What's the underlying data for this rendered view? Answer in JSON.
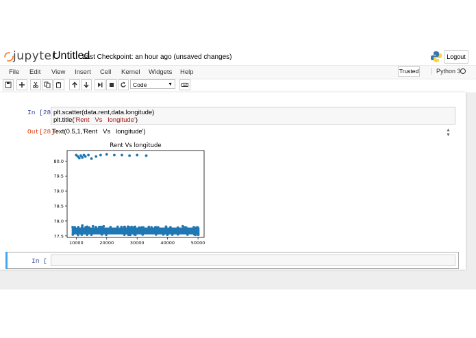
{
  "header": {
    "logo_text": "jupyter",
    "notebook_name": "Untitled",
    "checkpoint_label": "Last Checkpoint:",
    "checkpoint_time": "an hour ago",
    "checkpoint_status": "(unsaved changes)",
    "logout_label": "Logout"
  },
  "menu": {
    "items": [
      "File",
      "Edit",
      "View",
      "Insert",
      "Cell",
      "Kernel",
      "Widgets",
      "Help"
    ],
    "trusted_label": "Trusted",
    "kernel_name": "Python 3"
  },
  "toolbar": {
    "cell_type": "Code",
    "icons": [
      "save-icon",
      "plus-icon",
      "cut-icon",
      "copy-icon",
      "paste-icon",
      "arrow-up-icon",
      "arrow-down-icon",
      "step-forward-icon",
      "stop-icon",
      "restart-icon",
      "keyboard-icon"
    ]
  },
  "cells": [
    {
      "prompt_in": "In  [28]:",
      "code_line1": "plt.scatter(data.rent,data.longitude)",
      "code_line2_pre": "plt.title(",
      "code_line2_str": "'Rent   Vs   longitude'",
      "code_line2_post": ")",
      "prompt_out": "Out[28]:",
      "output_text": "Text(0.5,1,'Rent   Vs   longitude')"
    },
    {
      "prompt_in": "In  [  ]:"
    }
  ],
  "chart_data": {
    "type": "scatter",
    "title": "Rent Vs longitude",
    "xlabel": "",
    "ylabel": "",
    "xlim": [
      7000,
      52000
    ],
    "ylim": [
      77.45,
      80.35
    ],
    "xticks": [
      10000,
      20000,
      30000,
      40000,
      50000
    ],
    "yticks": [
      77.5,
      78.0,
      78.5,
      79.0,
      79.5,
      80.0
    ],
    "ytick_labels": [
      "77.5",
      "77.8",
      "78.0",
      "78.5",
      "79.0",
      "79.5",
      "80.0"
    ],
    "xtick_labels": [
      "10000",
      "20000",
      "30000",
      "40000",
      "50000"
    ],
    "color": "#1f77b4",
    "grid": false,
    "band": {
      "x_min": 8500,
      "x_max": 50500,
      "y_min": 77.55,
      "y_max": 77.78
    },
    "outliers_high": [
      [
        10000,
        80.2
      ],
      [
        10500,
        80.15
      ],
      [
        11000,
        80.1
      ],
      [
        11500,
        80.18
      ],
      [
        12000,
        80.12
      ],
      [
        12500,
        80.2
      ],
      [
        13000,
        80.15
      ],
      [
        14000,
        80.2
      ],
      [
        15000,
        80.08
      ],
      [
        16500,
        80.15
      ],
      [
        18000,
        80.2
      ],
      [
        20000,
        80.22
      ],
      [
        22500,
        80.2
      ],
      [
        25000,
        80.2
      ],
      [
        27500,
        80.18
      ],
      [
        30000,
        80.2
      ],
      [
        33000,
        80.18
      ]
    ],
    "outliers_band": [
      [
        12000,
        77.85
      ],
      [
        15500,
        77.82
      ],
      [
        19000,
        77.82
      ],
      [
        45000,
        77.82
      ],
      [
        49500,
        77.78
      ]
    ]
  }
}
